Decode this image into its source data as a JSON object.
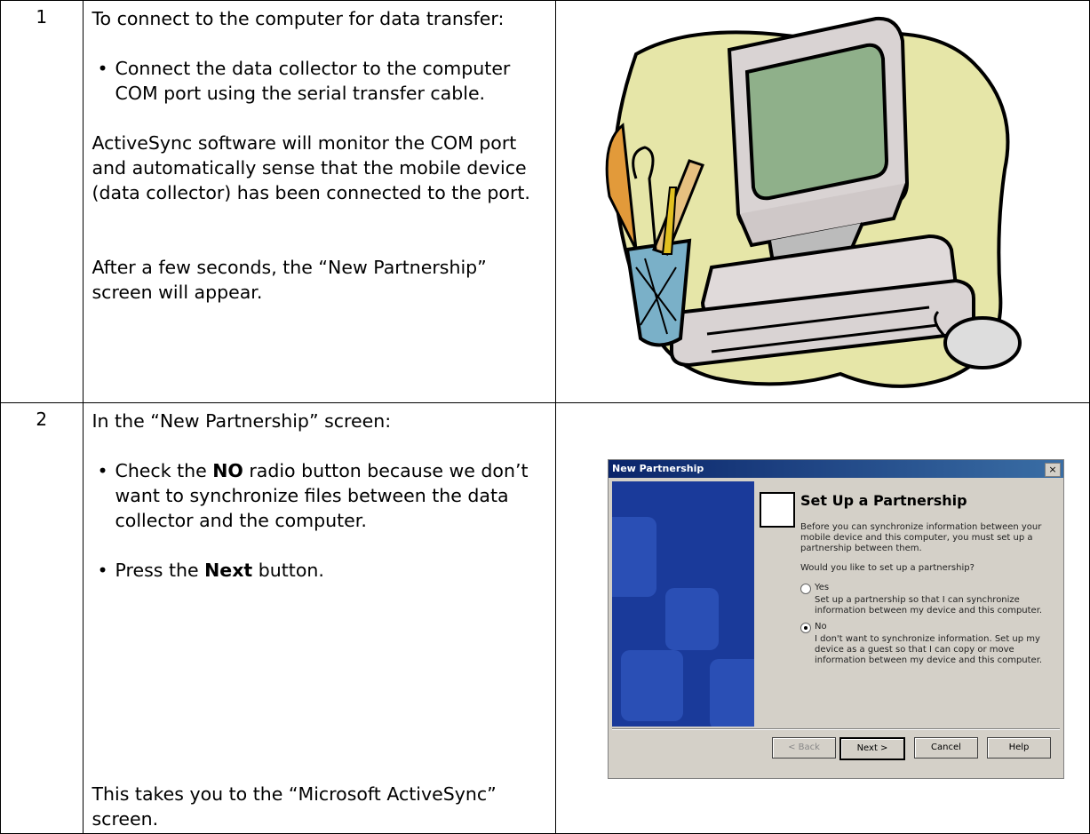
{
  "steps": [
    {
      "number": "1",
      "heading": "To connect to the computer for data transfer:",
      "bullet1": "Connect the data collector to the computer COM port using the serial transfer cable.",
      "para1": "ActiveSync software will monitor the COM port and automatically sense that the mobile device (data collector) has been connected to the port.",
      "para2": "After a few seconds, the “New Partnership” screen will appear."
    },
    {
      "number": "2",
      "heading": "In the “New Partnership” screen:",
      "bullet1_pre": "Check the ",
      "bullet1_bold": "NO",
      "bullet1_post": " radio button because we don’t want to synchronize files between the data collector and the computer.",
      "bullet2_pre": "Press the ",
      "bullet2_bold": "Next",
      "bullet2_post": " button.",
      "para": "This takes you to the “Microsoft ActiveSync” screen."
    }
  ],
  "dialog": {
    "title": "New Partnership",
    "close": "×",
    "heading": "Set Up a Partnership",
    "intro": "Before you can synchronize information between your mobile device and this computer, you must set up a partnership between them.",
    "question": "Would you like to set up a partnership?",
    "yes_label": "Yes",
    "yes_desc": "Set up a partnership so that I can synchronize information between my device and this computer.",
    "no_label": "No",
    "no_desc": "I don't want to synchronize information. Set up my device as a guest so that I can copy or move information between my device and this computer.",
    "buttons": {
      "back": "< Back",
      "next": "Next >",
      "cancel": "Cancel",
      "help": "Help"
    }
  },
  "bullet": "•"
}
